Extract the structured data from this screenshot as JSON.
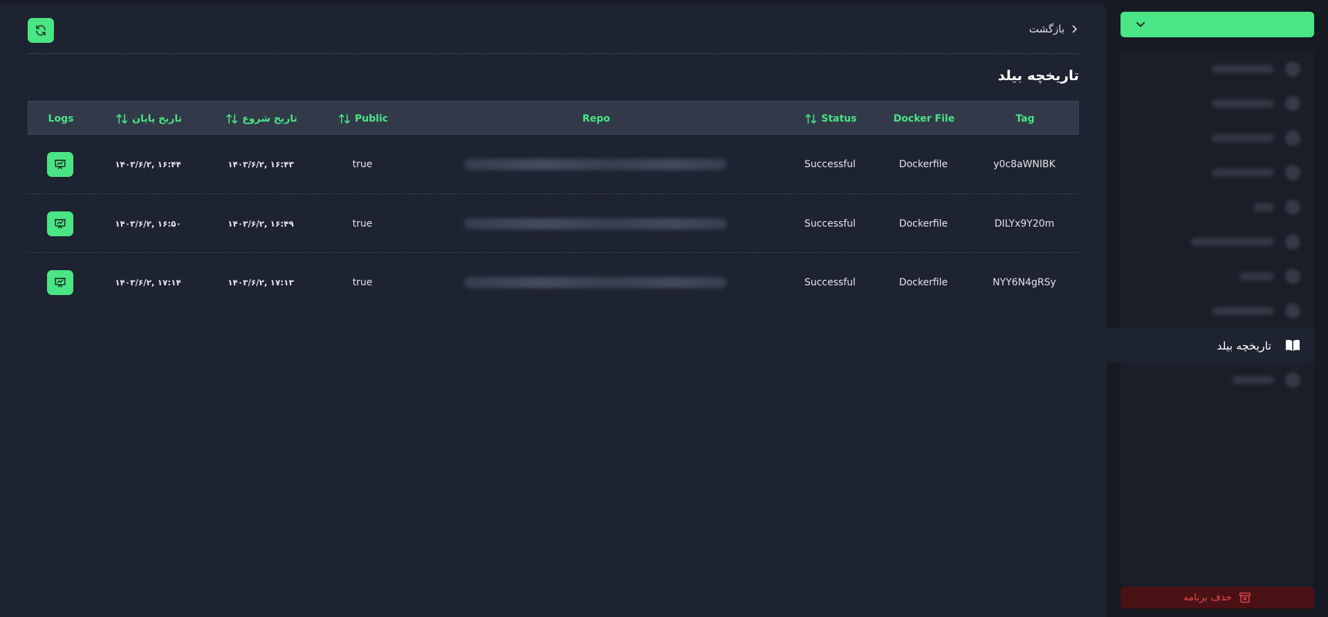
{
  "header": {
    "back_label": "بازگشت",
    "page_title": "تاریخچه بیلد"
  },
  "table": {
    "columns": {
      "tag": "Tag",
      "docker_file": "Docker File",
      "status": "Status",
      "repo": "Repo",
      "public": "Public",
      "start_date": "تاریخ شروع",
      "end_date": "تاریخ پایان",
      "logs": "Logs"
    },
    "rows": [
      {
        "tag": "y0c8aWNIBK",
        "docker_file": "Dockerfile",
        "status": "Successful",
        "public": "true",
        "start_date": "۱۶:۴۳ ,۱۴۰۳/۶/۲",
        "end_date": "۱۶:۴۴ ,۱۴۰۳/۶/۲"
      },
      {
        "tag": "DILYx9Y20m",
        "docker_file": "Dockerfile",
        "status": "Successful",
        "public": "true",
        "start_date": "۱۶:۴۹ ,۱۴۰۳/۶/۲",
        "end_date": "۱۶:۵۰ ,۱۴۰۳/۶/۲"
      },
      {
        "tag": "NYY6N4gRSy",
        "docker_file": "Dockerfile",
        "status": "Successful",
        "public": "true",
        "start_date": "۱۷:۱۳ ,۱۴۰۳/۶/۲",
        "end_date": "۱۷:۱۴ ,۱۴۰۳/۶/۲"
      }
    ]
  },
  "sidebar": {
    "active_item_label": "تاریخچه بیلد",
    "delete_label": "حذف برنامه"
  },
  "colors": {
    "accent": "#4ae584",
    "danger": "#e5484d",
    "panel": "#1e2331",
    "background": "#161a23"
  }
}
